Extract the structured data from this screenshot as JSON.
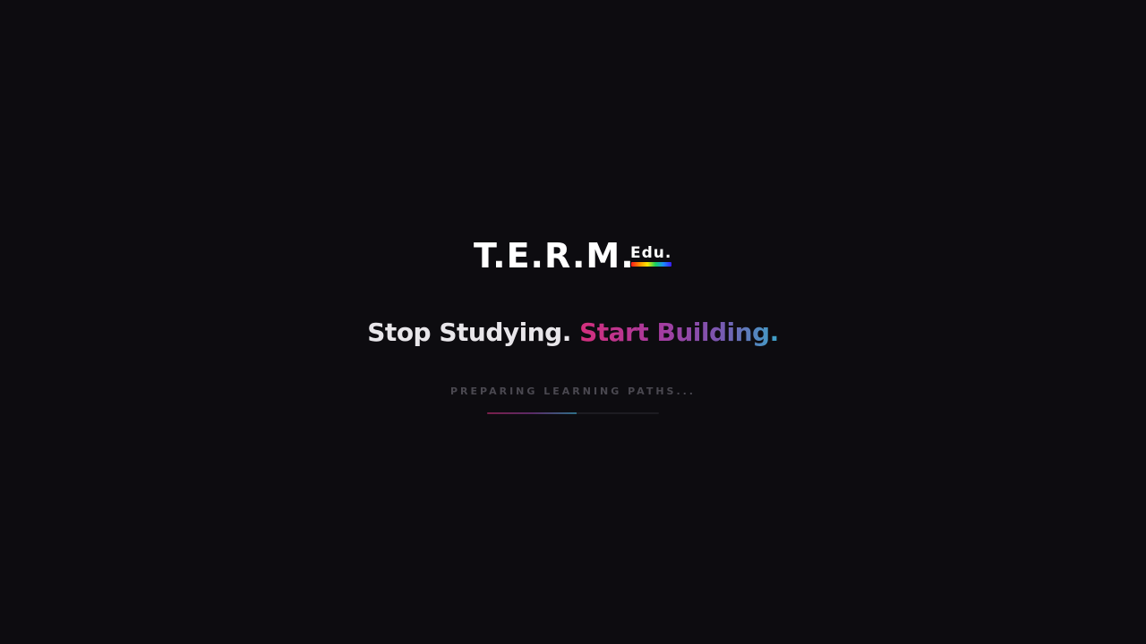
{
  "logo": {
    "main": "T.E.R.M.",
    "sub": "Edu."
  },
  "tagline": {
    "plain": "Stop Studying.",
    "accent": "Start Building."
  },
  "loader": {
    "status": "PREPARING LEARNING PATHS...",
    "progress": 0.52
  },
  "colors": {
    "background": "#0d0c10",
    "accent_start": "#d42f7c",
    "accent_mid": "#a63ba0",
    "accent_end": "#3da3c8"
  }
}
